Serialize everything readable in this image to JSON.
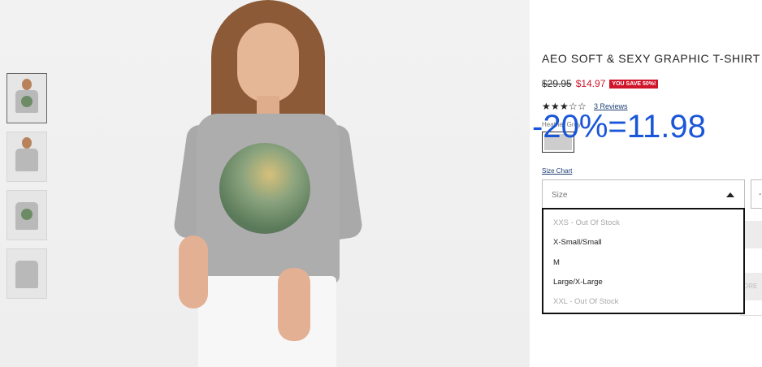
{
  "product": {
    "title": "AEO SOFT & SEXY GRAPHIC T-SHIRT",
    "old_price": "$29.95",
    "new_price": "$14.97",
    "save_badge": "YOU SAVE 50%!",
    "rating": 3,
    "rating_max": 5,
    "reviews_label": "3 Reviews",
    "color_label": "Heather Grey"
  },
  "overlay": {
    "text": "-20%=11.98",
    "color": "#1a56d8"
  },
  "size": {
    "chart_link": "Size Chart",
    "placeholder": "Size",
    "options": [
      {
        "label": "XXS - Out Of Stock",
        "available": false
      },
      {
        "label": "X-Small/Small",
        "available": true
      },
      {
        "label": "M",
        "available": true
      },
      {
        "label": "Large/X-Large",
        "available": true
      },
      {
        "label": "XXL - Out Of Stock",
        "available": false
      }
    ]
  },
  "quantity": {
    "value": "-"
  },
  "partial_button": {
    "label": "ORE"
  },
  "colors": {
    "sale_red": "#d0142a",
    "link_blue": "#1f3f73",
    "swatch_grey": "#cdcdcd"
  }
}
